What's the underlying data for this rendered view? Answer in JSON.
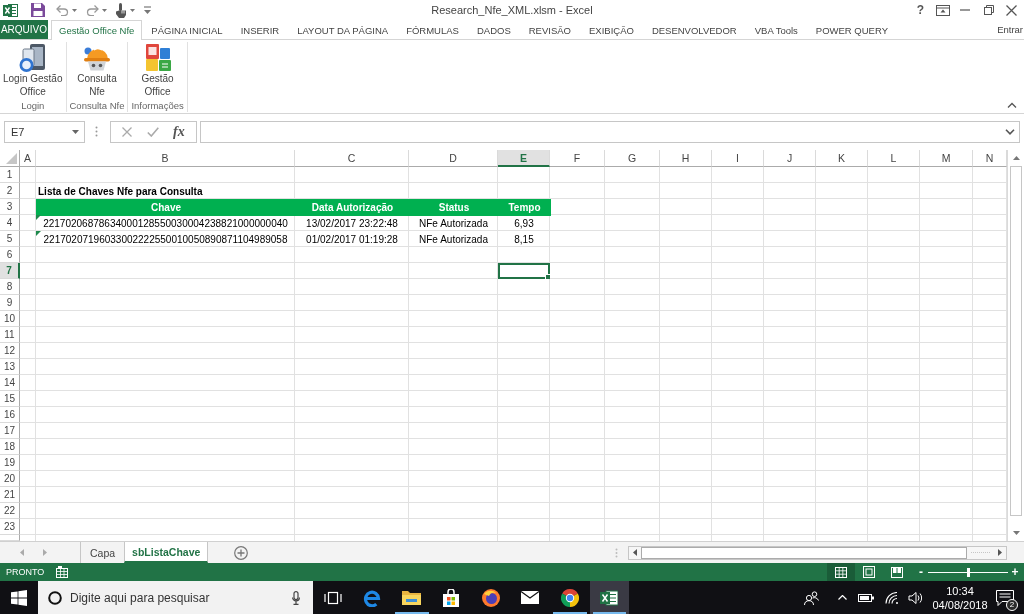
{
  "window": {
    "title": "Research_Nfe_XML.xlsm - Excel",
    "help": "?"
  },
  "ribbon": {
    "file_tab": "ARQUIVO",
    "tabs": [
      {
        "label": "Gestão Office Nfe",
        "selected": true
      },
      {
        "label": "PÁGINA INICIAL",
        "selected": false
      },
      {
        "label": "INSERIR",
        "selected": false
      },
      {
        "label": "LAYOUT DA PÁGINA",
        "selected": false
      },
      {
        "label": "FÓRMULAS",
        "selected": false
      },
      {
        "label": "DADOS",
        "selected": false
      },
      {
        "label": "REVISÃO",
        "selected": false
      },
      {
        "label": "EXIBIÇÃO",
        "selected": false
      },
      {
        "label": "DESENVOLVEDOR",
        "selected": false
      },
      {
        "label": "VBA Tools",
        "selected": false
      },
      {
        "label": "POWER QUERY",
        "selected": false
      }
    ],
    "account": "Entrar",
    "groups": [
      {
        "label": "Login",
        "buttons": [
          {
            "kind": "computer",
            "label": "Login Gestão\nOffice"
          }
        ]
      },
      {
        "label": "Consulta Nfe",
        "buttons": [
          {
            "kind": "hard_hat",
            "label": "Consulta\nNfe"
          }
        ]
      },
      {
        "label": "Informações",
        "buttons": [
          {
            "kind": "documents",
            "label": "Gestão\nOffice"
          }
        ]
      }
    ]
  },
  "formula_bar": {
    "name_box": "E7",
    "function_label": "fx"
  },
  "sheet": {
    "columns": [
      {
        "label": "A",
        "selected": false
      },
      {
        "label": "B",
        "selected": false
      },
      {
        "label": "C",
        "selected": false
      },
      {
        "label": "D",
        "selected": false
      },
      {
        "label": "E",
        "selected": true
      },
      {
        "label": "F",
        "selected": false
      },
      {
        "label": "G",
        "selected": false
      },
      {
        "label": "H",
        "selected": false
      },
      {
        "label": "I",
        "selected": false
      },
      {
        "label": "J",
        "selected": false
      },
      {
        "label": "K",
        "selected": false
      },
      {
        "label": "L",
        "selected": false
      },
      {
        "label": "M",
        "selected": false
      },
      {
        "label": "N",
        "selected": false
      }
    ],
    "rows": [
      {
        "label": "1",
        "selected": false
      },
      {
        "label": "2",
        "selected": false
      },
      {
        "label": "3",
        "selected": false
      },
      {
        "label": "4",
        "selected": false
      },
      {
        "label": "5",
        "selected": false
      },
      {
        "label": "6",
        "selected": false
      },
      {
        "label": "7",
        "selected": true
      },
      {
        "label": "8",
        "selected": false
      },
      {
        "label": "9",
        "selected": false
      },
      {
        "label": "10",
        "selected": false
      },
      {
        "label": "11",
        "selected": false
      },
      {
        "label": "12",
        "selected": false
      },
      {
        "label": "13",
        "selected": false
      },
      {
        "label": "14",
        "selected": false
      },
      {
        "label": "15",
        "selected": false
      },
      {
        "label": "16",
        "selected": false
      },
      {
        "label": "17",
        "selected": false
      },
      {
        "label": "18",
        "selected": false
      },
      {
        "label": "19",
        "selected": false
      },
      {
        "label": "20",
        "selected": false
      },
      {
        "label": "21",
        "selected": false
      },
      {
        "label": "22",
        "selected": false
      },
      {
        "label": "23",
        "selected": false
      }
    ],
    "title": "Lista de Chaves Nfe para Consulta",
    "table": {
      "columns": [
        "Chave",
        "Data Autorização",
        "Status",
        "Tempo"
      ],
      "rows": [
        {
          "flagged": true,
          "cells": [
            "22170206878634000128550030004238821000000040",
            "13/02/2017 23:22:48",
            "NFe Autorizada",
            "6,93"
          ]
        },
        {
          "flagged": true,
          "cells": [
            "22170207196033002222550010050890871104989058",
            "01/02/2017 01:19:28",
            "NFe Autorizada",
            "8,15"
          ]
        }
      ]
    }
  },
  "sheet_tabs": [
    {
      "label": "Capa",
      "selected": false
    },
    {
      "label": "sbListaChave",
      "selected": true
    }
  ],
  "status_bar": {
    "status": "PRONTO",
    "views": [
      {
        "kind": "normal",
        "selected": true
      },
      {
        "kind": "page_layout",
        "selected": false
      },
      {
        "kind": "page_break",
        "selected": false
      }
    ],
    "zoom": {
      "zoom_out": "-",
      "zoom_in": "+",
      "level": 0.5
    }
  },
  "taskbar": {
    "search": {
      "placeholder": "Digite aqui para pesquisar"
    },
    "apps": [
      {
        "kind": "task_view",
        "running": false,
        "selected": false
      },
      {
        "kind": "edge",
        "running": false,
        "selected": false
      },
      {
        "kind": "explorer",
        "running": true,
        "selected": false
      },
      {
        "kind": "store",
        "running": false,
        "selected": false
      },
      {
        "kind": "firefox",
        "running": false,
        "selected": false
      },
      {
        "kind": "mail",
        "running": false,
        "selected": false
      },
      {
        "kind": "chrome",
        "running": true,
        "selected": false
      },
      {
        "kind": "excel",
        "running": true,
        "selected": true
      }
    ],
    "clock": {
      "time": "10:34",
      "date": "04/08/2018"
    },
    "notification_count": "2"
  }
}
